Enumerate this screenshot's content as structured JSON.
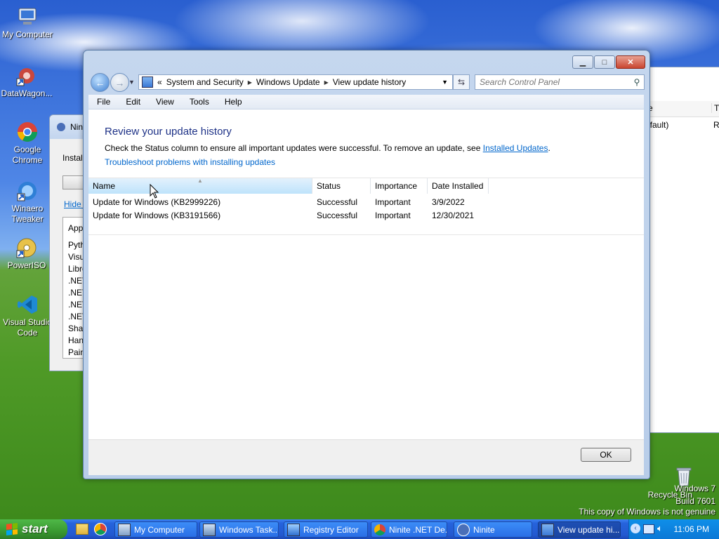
{
  "desktop": {
    "icons": [
      {
        "label": "My Computer",
        "icon": "computer-icon"
      },
      {
        "label": "DataWagon...",
        "icon": "datawagon-icon"
      },
      {
        "label": "Google Chrome",
        "icon": "chrome-icon"
      },
      {
        "label": "Winaero Tweaker",
        "icon": "winaero-icon"
      },
      {
        "label": "PowerISO",
        "icon": "poweriso-icon"
      },
      {
        "label": "Visual Studio Code",
        "icon": "vscode-icon"
      },
      {
        "label": "Recycle Bin",
        "icon": "recycle-bin-icon"
      }
    ],
    "watermark": {
      "line1": "Windows 7",
      "line2": "Build 7601",
      "line3": "This copy of Windows is not genuine"
    }
  },
  "background_windows": {
    "ninite_title": "Nini",
    "ninite_install": "Install",
    "ninite_hide": "Hide d",
    "ninite_list_header": "Appl",
    "ninite_list": [
      "Pyth",
      "Visua",
      "Libre",
      ".NET",
      ".NET",
      ".NET",
      ".NET",
      "Shar",
      "Hand",
      "Paint"
    ],
    "right_header": [
      "e",
      "Ty"
    ],
    "right_row": [
      "efault)",
      "R"
    ]
  },
  "window": {
    "caption_buttons": {
      "minimize": "▁",
      "maximize": "□",
      "close": "✕"
    },
    "address": {
      "recent": "«",
      "crumbs": [
        "System and Security",
        "Windows Update",
        "View update history"
      ]
    },
    "search": {
      "placeholder": "Search Control Panel"
    },
    "menu": [
      "File",
      "Edit",
      "View",
      "Tools",
      "Help"
    ],
    "heading": "Review your update history",
    "description": "Check the Status column to ensure all important updates were successful. To remove an update, see",
    "description_link": "Installed Updates",
    "description_end": ".",
    "troubleshoot": "Troubleshoot problems with installing updates",
    "columns": [
      "Name",
      "Status",
      "Importance",
      "Date Installed"
    ],
    "rows": [
      {
        "name": "Update for Windows (KB2999226)",
        "status": "Successful",
        "importance": "Important",
        "date": "3/9/2022"
      },
      {
        "name": "Update for Windows (KB3191566)",
        "status": "Successful",
        "importance": "Important",
        "date": "12/30/2021"
      }
    ],
    "ok_label": "OK"
  },
  "taskbar": {
    "start_label": "start",
    "buttons": [
      {
        "label": "My Computer",
        "icon": "computer-icon"
      },
      {
        "label": "Windows Task...",
        "icon": "task-manager-icon"
      },
      {
        "label": "Registry Editor",
        "icon": "registry-editor-icon"
      },
      {
        "label": "Ninite .NET De...",
        "icon": "chrome-icon"
      },
      {
        "label": "Ninite",
        "icon": "ninite-icon"
      },
      {
        "label": "View update hi...",
        "icon": "control-panel-icon"
      }
    ],
    "clock": "11:06 PM"
  }
}
